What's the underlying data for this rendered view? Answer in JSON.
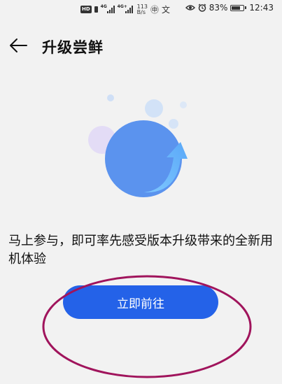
{
  "status_bar": {
    "hd": "HD",
    "signal1_tag": "4G",
    "signal2_tag": "4G+",
    "net_speed_value": "113",
    "net_speed_unit": "B/s",
    "glyph1": "㊥",
    "glyph2": "文",
    "battery_percent": "83%",
    "battery_level": 0.83,
    "time": "12:43"
  },
  "header": {
    "title": "升级尝鲜"
  },
  "main": {
    "description": "马上参与，即可率先感受版本升级带来的全新用机体验",
    "cta_label": "立即前往"
  },
  "colors": {
    "accent": "#2462e8",
    "annotation": "#a0145c",
    "background": "#f2f2f2"
  },
  "icons": {
    "back": "back-arrow-icon",
    "upgrade": "upgrade-illustration",
    "eye": "eye-icon",
    "alarm": "alarm-icon",
    "battery": "battery-icon"
  }
}
